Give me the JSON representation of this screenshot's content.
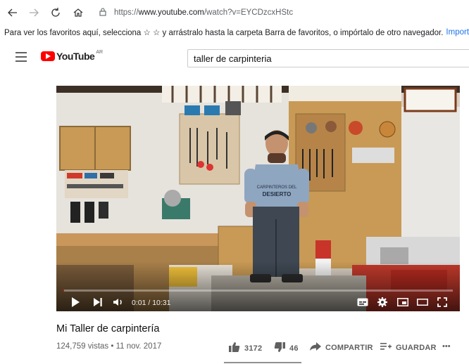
{
  "browser": {
    "url_prefix": "https://",
    "url_host": "www.youtube.com",
    "url_path": "/watch?v=EYCDzcxHStc"
  },
  "favorites_bar": {
    "message": "Para ver los favoritos aquí, selecciona ☆ ☆ y arrástralo hasta la carpeta Barra de favoritos, o impórtalo de otro navegador.",
    "import_link": "Importar favoritos"
  },
  "youtube": {
    "logo_text": "YouTube",
    "region": "AR",
    "search_value": "taller de carpinteria"
  },
  "player": {
    "time": "0:01 / 10:31",
    "progress_fraction": 0.002,
    "shirt_text_1": "CARPINTEROS DEL",
    "shirt_text_2": "DESIERTO"
  },
  "video_info": {
    "title": "Mi Taller de carpintería",
    "views": "124,759 vistas • 11 nov. 2017",
    "likes": "3172",
    "dislikes": "46",
    "share_label": "COMPARTIR",
    "save_label": "GUARDAR",
    "more_label": "•••"
  },
  "icons": [
    "back-icon",
    "forward-icon",
    "reload-icon",
    "home-icon",
    "lock-icon",
    "menu-icon",
    "play-icon",
    "next-icon",
    "volume-icon",
    "subtitles-icon",
    "settings-icon",
    "miniplayer-icon",
    "theater-icon",
    "fullscreen-icon",
    "like-icon",
    "dislike-icon",
    "share-icon",
    "save-icon"
  ],
  "colors": {
    "brand_red": "#ff0000",
    "link_blue": "#1a73e8"
  }
}
